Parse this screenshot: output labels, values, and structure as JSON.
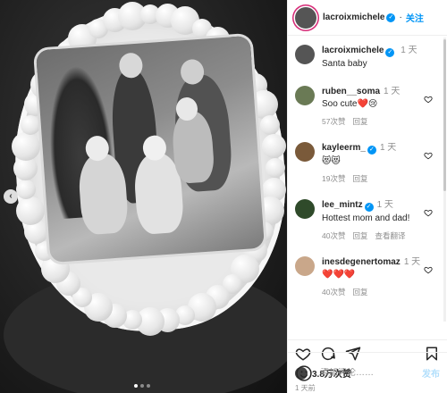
{
  "post": {
    "username": "lacroixmichele",
    "follow_label": "关注",
    "caption_username": "lacroixmichele",
    "caption_time": "1 天",
    "caption_text": "Santa baby"
  },
  "comments": [
    {
      "username": "ruben__soma",
      "time": "1 天",
      "text": "Soo cute❤️😢",
      "likes": "57次赞",
      "reply": "回复",
      "translate": "",
      "avatar_color": "#6a7a55"
    },
    {
      "username": "kayleerm_",
      "time": "1 天",
      "text": "😻😻",
      "likes": "19次赞",
      "reply": "回复",
      "translate": "",
      "avatar_color": "#7a5a3a"
    },
    {
      "username": "lee_mintz",
      "time": "1 天",
      "text": "Hottest mom and dad!",
      "likes": "40次赞",
      "reply": "回复",
      "translate": "查看翻译",
      "avatar_color": "#2f4a2a"
    },
    {
      "username": "inesdegenertomaz",
      "time": "1 天",
      "text": "❤️❤️❤️",
      "likes": "40次赞",
      "reply": "回复",
      "translate": "",
      "avatar_color": "#c9a78a"
    }
  ],
  "likes_count": "3.8万次赞",
  "date": "1 天前",
  "comment_input": {
    "placeholder": "添加评论……",
    "post_label": "发布"
  },
  "icons": {
    "like": "heart-icon",
    "comment": "comment-icon",
    "share": "share-icon",
    "save": "bookmark-icon",
    "emoji": "emoji-icon",
    "carousel_prev": "chevron-left-icon"
  },
  "colors": {
    "accent": "#0095f6",
    "heart": "#ed4956"
  }
}
